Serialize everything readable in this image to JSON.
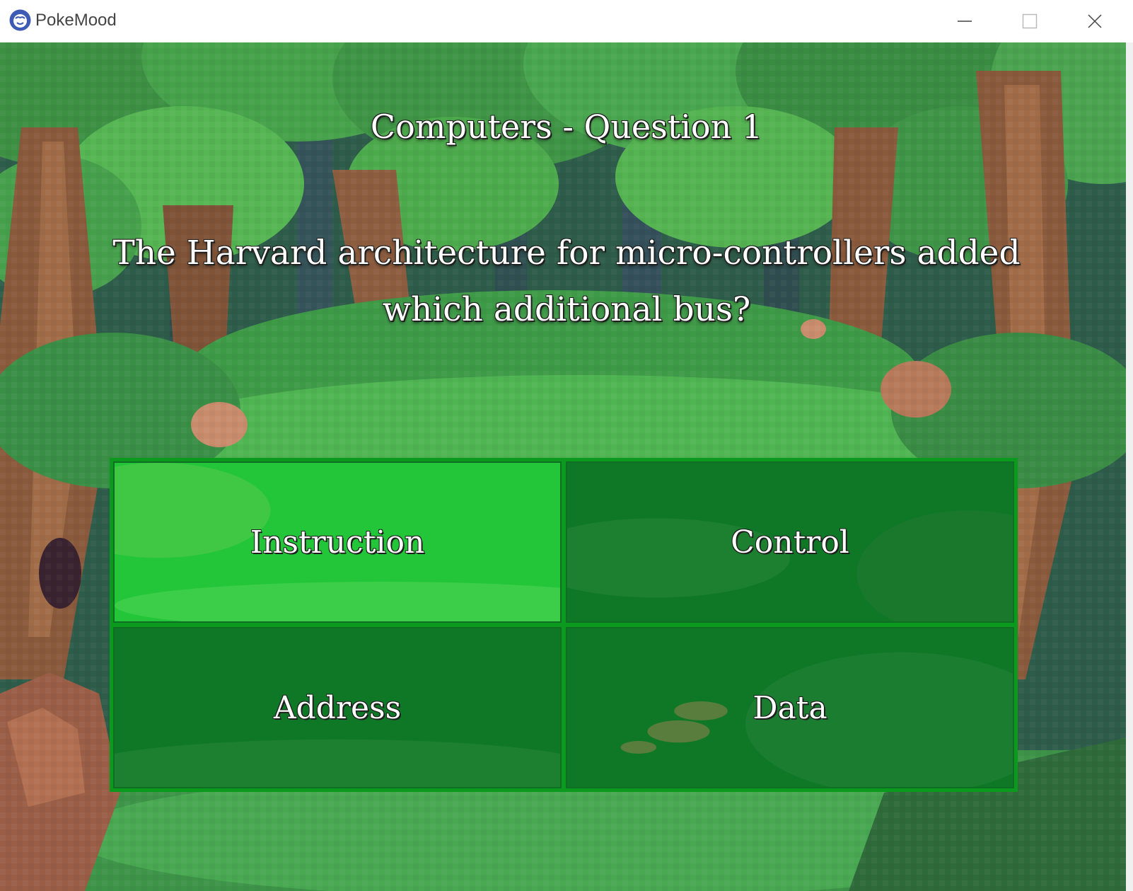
{
  "window": {
    "app_title": "PokeMood",
    "controls": {
      "minimize_icon": "minimize-icon",
      "maximize_icon": "maximize-icon",
      "close_icon": "close-icon"
    }
  },
  "quiz": {
    "heading": "Computers - Question 1",
    "question": "The Harvard architecture for micro-controllers added which additional bus?",
    "answers": [
      {
        "label": "Instruction",
        "state": "highlighted"
      },
      {
        "label": "Control",
        "state": "normal"
      },
      {
        "label": "Address",
        "state": "normal"
      },
      {
        "label": "Data",
        "state": "normal"
      }
    ]
  },
  "colors": {
    "answer_highlight": "#26cd3c",
    "answer_normal": "#10702a",
    "answer_border": "#0b9a1e",
    "forest_dark": "#2f5b44",
    "forest_canopy": "#3f9a4a",
    "trunk": "#8a5a3c"
  }
}
